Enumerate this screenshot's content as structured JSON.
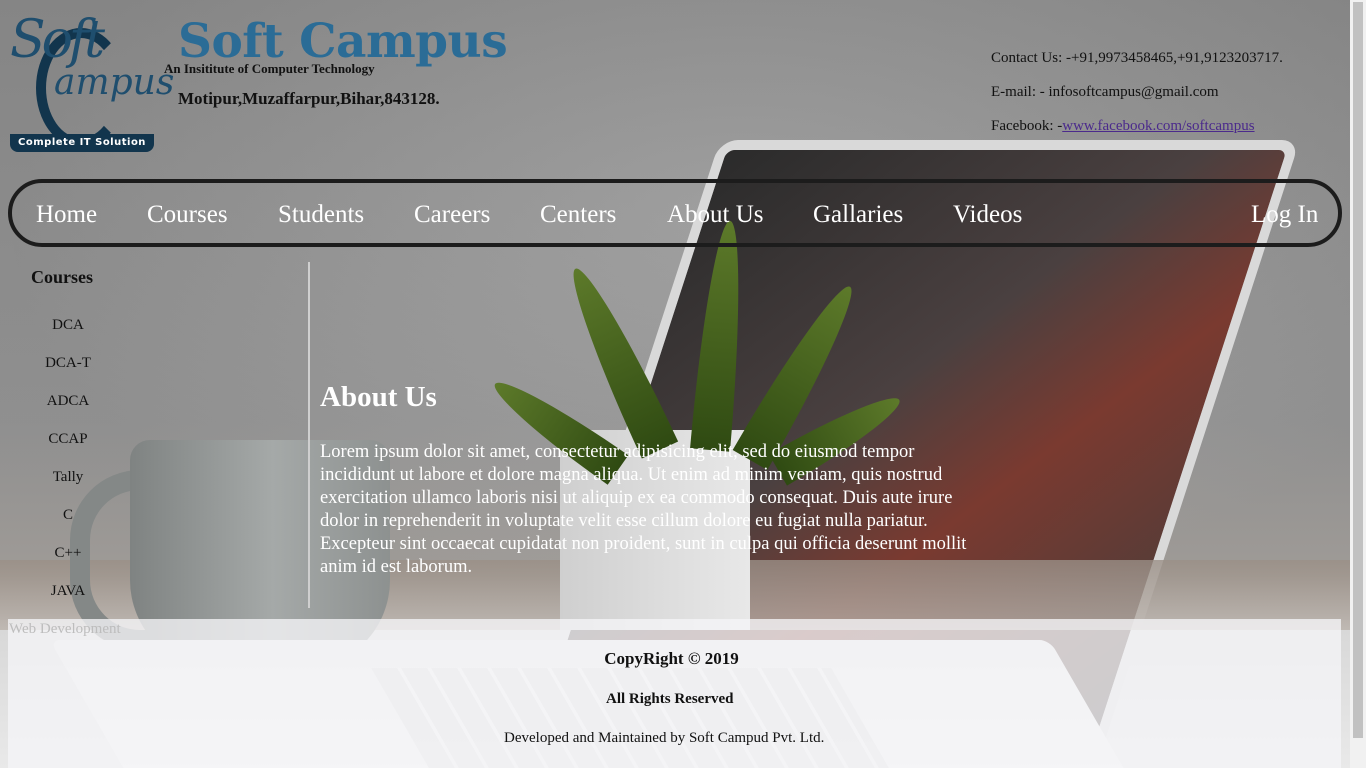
{
  "header": {
    "logo_script_1": "Soft",
    "logo_script_2": "ampus",
    "logo_tagline": "Complete IT Solution",
    "brand_name": "Soft Campus",
    "brand_tagline": "An Insititute of Computer Technology",
    "address": "Motipur,Muzaffarpur,Bihar,843128."
  },
  "contact": {
    "phone_label": "Contact Us: -",
    "phone_value": "+91,9973458465,+91,9123203717.",
    "email_label": "E-mail: - ",
    "email_value": "infosoftcampus@gmail.com",
    "facebook_label": "Facebook: -",
    "facebook_link": "www.facebook.com/softcampus"
  },
  "nav": {
    "items": [
      "Home",
      "Courses",
      "Students",
      "Careers",
      "Centers",
      "About Us",
      "Gallaries",
      "Videos"
    ],
    "login": "Log In"
  },
  "sidebar": {
    "title": "Courses",
    "items": [
      "DCA",
      "DCA-T",
      "ADCA",
      "CCAP",
      "Tally",
      "C",
      "C++",
      "JAVA",
      "Web Development"
    ]
  },
  "main": {
    "title": "About Us",
    "text": "Lorem ipsum dolor sit amet, consectetur adipisicing elit, sed do eiusmod tempor incididunt ut labore et dolore magna aliqua. Ut enim ad minim veniam, quis nostrud exercitation ullamco laboris nisi ut aliquip ex ea commodo consequat. Duis aute irure dolor in reprehenderit in voluptate velit esse cillum dolore eu fugiat nulla pariatur. Excepteur sint occaecat cupidatat non proident, sunt in culpa qui officia deserunt mollit anim id est laborum."
  },
  "footer": {
    "copyright": "CopyRight © 2019",
    "rights": "All Rights Reserved",
    "developed_by": "Developed and Maintained by Soft Campud Pvt. Ltd."
  },
  "colors": {
    "brand": "#2b6c96",
    "logo_dark": "#12354d",
    "link": "#4b2a8c",
    "nav_border": "#1c1c1c"
  }
}
